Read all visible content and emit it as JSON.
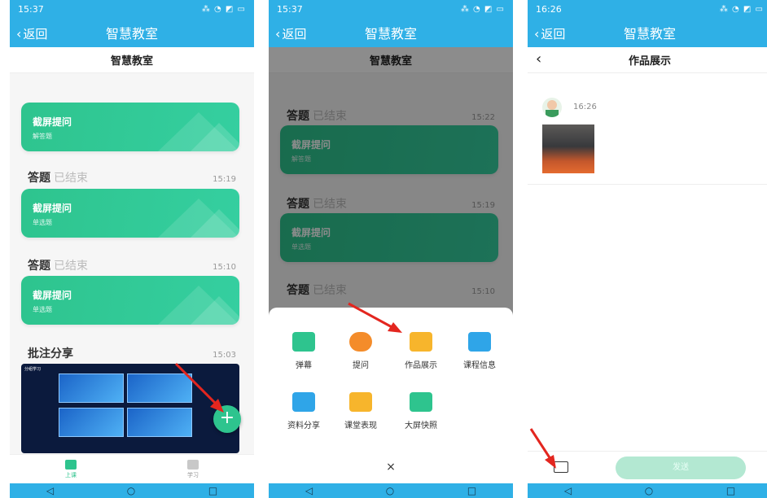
{
  "phone1": {
    "status_time": "15:37",
    "nav_back": "返回",
    "nav_title": "智慧教室",
    "subheader": "智慧教室",
    "cards": [
      {
        "title": "截屏提问",
        "subtitle": "解答题"
      },
      {
        "title": "截屏提问",
        "subtitle": "单选题"
      },
      {
        "title": "截屏提问",
        "subtitle": "单选题"
      }
    ],
    "sections": [
      {
        "title": "答题",
        "status": "已结束",
        "time": "15:19"
      },
      {
        "title": "答题",
        "status": "已结束",
        "time": "15:10"
      },
      {
        "title": "批注分享",
        "status": "",
        "time": "15:03"
      }
    ],
    "screenshot_title": "分组学习",
    "tabs": [
      {
        "label": "上课"
      },
      {
        "label": "学习"
      }
    ],
    "fab": "+",
    "sysnav": [
      "◁",
      "○",
      "□"
    ]
  },
  "phone2": {
    "status_time": "15:37",
    "nav_back": "返回",
    "nav_title": "智慧教室",
    "subheader": "智慧教室",
    "sections": [
      {
        "title": "答题",
        "status": "已结束",
        "time": "15:22",
        "card_title": "截屏提问",
        "card_sub": "解答题"
      },
      {
        "title": "答题",
        "status": "已结束",
        "time": "15:19",
        "card_title": "截屏提问",
        "card_sub": "单选题"
      },
      {
        "title": "答题",
        "status": "已结束",
        "time": "15:10"
      }
    ],
    "menu": [
      {
        "label": "弹幕",
        "icon": "danmaku-icon",
        "color": "#2ec48e"
      },
      {
        "label": "提问",
        "icon": "question-icon",
        "color": "#f48c2a"
      },
      {
        "label": "作品展示",
        "icon": "gallery-icon",
        "color": "#f7b52c"
      },
      {
        "label": "课程信息",
        "icon": "course-info-icon",
        "color": "#2fa5e8"
      },
      {
        "label": "资料分享",
        "icon": "file-share-icon",
        "color": "#2fa5e8"
      },
      {
        "label": "课堂表现",
        "icon": "thumbs-up-icon",
        "color": "#f7b52c"
      },
      {
        "label": "大屏快照",
        "icon": "camera-icon",
        "color": "#2ec48e"
      }
    ],
    "close": "×",
    "sysnav": [
      "◁",
      "○",
      "□"
    ]
  },
  "phone3": {
    "status_time": "16:26",
    "nav_back": "返回",
    "nav_title": "智慧教室",
    "subheader": "作品展示",
    "post_time": "16:26",
    "send_label": "发送",
    "sysnav": [
      "◁",
      "○",
      "□"
    ]
  },
  "colors": {
    "primary": "#2fb0e6",
    "accent": "#2ec48e",
    "arrow": "#e3261f"
  }
}
